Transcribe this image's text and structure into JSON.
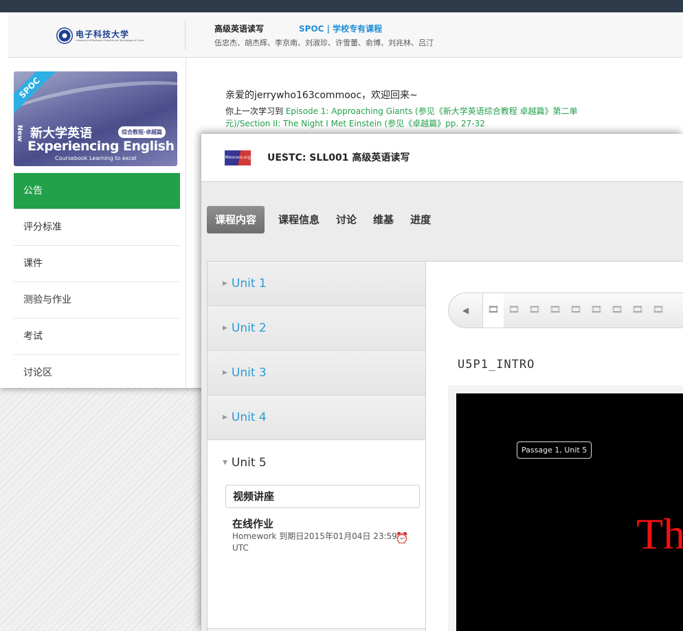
{
  "back": {
    "logo": {
      "zh": "电子科技大学",
      "en": "University of Electronic Science and Technology of China"
    },
    "course_title": "高级英语读写",
    "course_tag": "SPOC | 学校专有课程",
    "teachers": "伍忠杰、胡杰辉、李京南、刘淑珍、许雪蕾、俞博、刘兆林、吕汀",
    "cover": {
      "ribbon": "SPOC",
      "zh_title": "新大学英语",
      "edition": "综合教程·卓越篇",
      "new": "New",
      "en_title": "Experiencing English",
      "subtitle": "Coursebook  Learning to excel"
    },
    "menu": [
      "公告",
      "评分标准",
      "课件",
      "测验与作业",
      "考试",
      "讨论区"
    ],
    "welcome": "亲爱的jerrywho163commooc，欢迎回来~",
    "last_prefix": "你上一次学习到",
    "last_link": "Episode 1: Approaching Giants (参见《新大学英语综合教程 卓越篇》第二单元)/Section II: The Night I Met Einstein (参见《卓越篇》pp. 27-32"
  },
  "front": {
    "logo_text": "Moocers.org",
    "title": "UESTC: SLL001 高级英语读写",
    "tabs": [
      "课程内容",
      "课程信息",
      "讨论",
      "维基",
      "进度"
    ],
    "units": [
      "Unit 1",
      "Unit 2",
      "Unit 3",
      "Unit 4",
      "Unit 5"
    ],
    "unit5": {
      "video_lecture": "视频讲座",
      "homework_title": "在线作业",
      "homework_due": "Homework 到期日2015年01月04日 23:59 UTC"
    },
    "seq_prev": "◀",
    "seq_item_glyph": "🎞",
    "unit_title": "U5P1_INTRO",
    "video_caption": "Passage 1, Unit 5",
    "video_big_text": "Th"
  }
}
